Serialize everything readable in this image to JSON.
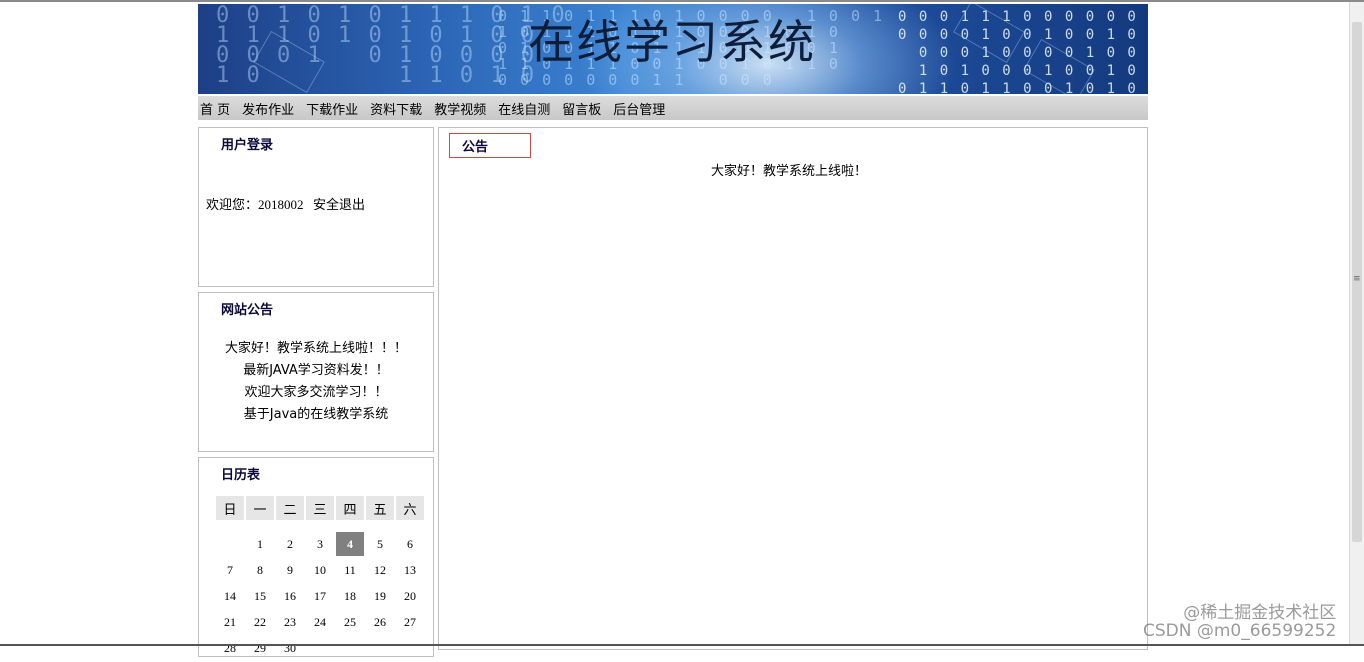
{
  "banner": {
    "title": "在线学习系统"
  },
  "nav": {
    "items": [
      {
        "label": "首 页"
      },
      {
        "label": "发布作业"
      },
      {
        "label": "下载作业"
      },
      {
        "label": "资料下载"
      },
      {
        "label": "教学视频"
      },
      {
        "label": "在线自测"
      },
      {
        "label": "留言板"
      },
      {
        "label": "后台管理"
      }
    ]
  },
  "login": {
    "title": "用户登录",
    "welcome": "欢迎您：2018002",
    "logout": "安全退出"
  },
  "notice": {
    "title": "网站公告",
    "items": [
      "大家好！教学系统上线啦！！！",
      "最新JAVA学习资料发！！",
      "欢迎大家多交流学习！！",
      "基于Java的在线教学系统"
    ]
  },
  "calendar": {
    "title": "日历表",
    "weekdays": [
      "日",
      "一",
      "二",
      "三",
      "四",
      "五",
      "六"
    ],
    "today": "4",
    "weeks": [
      [
        "",
        "1",
        "2",
        "3",
        "4",
        "5",
        "6"
      ],
      [
        "7",
        "8",
        "9",
        "10",
        "11",
        "12",
        "13"
      ],
      [
        "14",
        "15",
        "16",
        "17",
        "18",
        "19",
        "20"
      ],
      [
        "21",
        "22",
        "23",
        "24",
        "25",
        "26",
        "27"
      ],
      [
        "28",
        "29",
        "30",
        "",
        "",
        "",
        ""
      ]
    ]
  },
  "main": {
    "tag": "公告",
    "message": "大家好！教学系统上线啦！"
  },
  "watermark": {
    "line1": "@稀土掘金技术社区",
    "line2": "CSDN @m0_66599252"
  }
}
